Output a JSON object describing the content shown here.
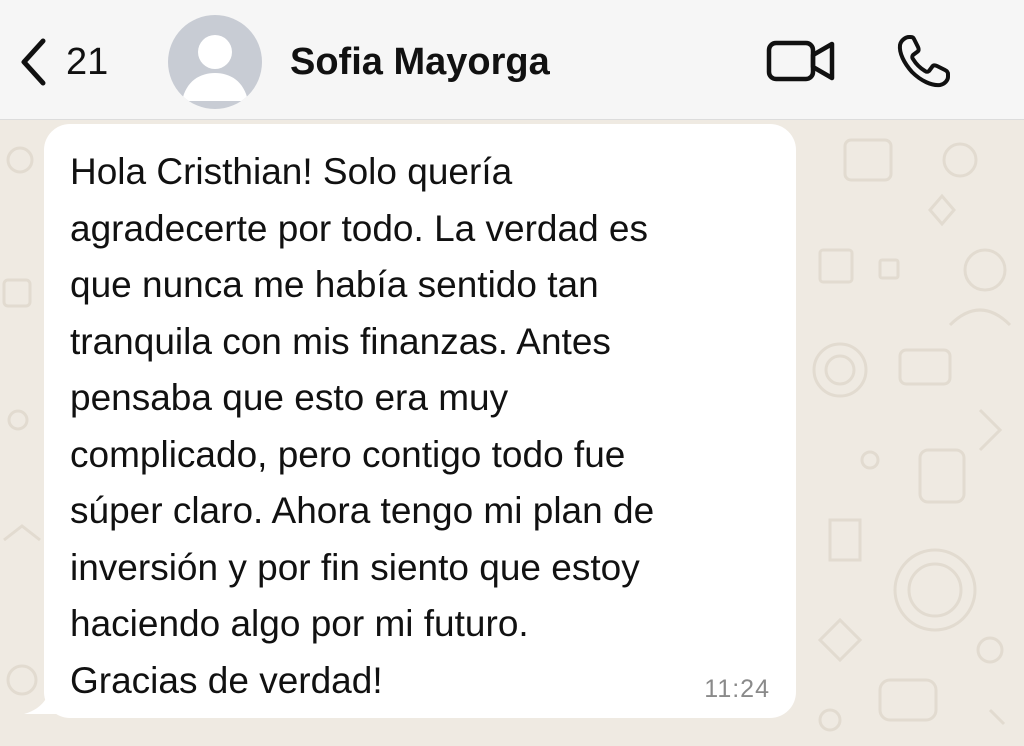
{
  "header": {
    "unread_count": "21",
    "contact_name": "Sofia Mayorga",
    "icons": {
      "back": "chevron-left-icon",
      "avatar": "default-person-avatar",
      "video": "video-camera-icon",
      "phone": "phone-icon"
    }
  },
  "chat": {
    "messages": [
      {
        "direction": "incoming",
        "lines": [
          "Hola Cristhian! Solo quería",
          "agradecerte por todo. La verdad es",
          "que nunca me había sentido tan",
          "tranquila con mis finanzas. Antes",
          "pensaba que esto era muy",
          "complicado, pero contigo todo fue",
          "súper claro. Ahora tengo mi plan de",
          "inversión y por fin siento que estoy",
          "haciendo algo por mi futuro.",
          "Gracias de verdad!"
        ],
        "time": "11:24"
      }
    ]
  },
  "colors": {
    "header_bg": "#f6f6f6",
    "chat_bg": "#efeae2",
    "bubble_bg": "#ffffff",
    "text": "#111111",
    "timestamp": "#8a8a8a",
    "avatar_bg": "#c8ccd4"
  }
}
